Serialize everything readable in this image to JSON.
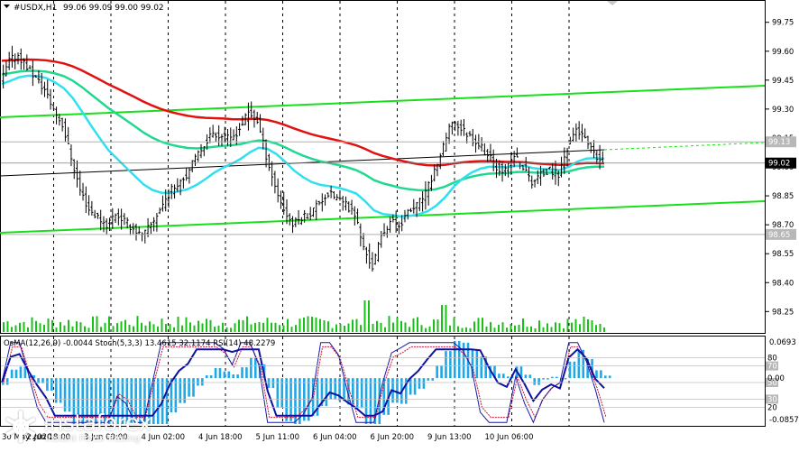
{
  "chart_info": {
    "symbol_label": "#USDX,H1",
    "ohlc_text": "99.06 99.09 99.00 99.02",
    "indicators_text": "OsMA(12,26,9) -0.0044  Stoch(5,3,3) 13.4615 32.1174  RSI(14) 48.2279"
  },
  "colors": {
    "ema_red": "#e31010",
    "ema_green": "#20d890",
    "ema_cyan": "#30e0f0",
    "channel_green": "#18e018",
    "trend_black": "#000000",
    "osma_bars": "#1fa8e8",
    "stoch_main": "#1a1aa8",
    "stoch_signal": "#d01030",
    "rsi_line": "#1010a0",
    "volume_bars": "#18c018",
    "current_price_box": "#000000",
    "level_box": "#b8b8b8"
  },
  "price_axis": {
    "labels": [
      "99.75",
      "99.60",
      "99.45",
      "99.30",
      "99.15",
      "99.00",
      "98.85",
      "98.70",
      "98.55",
      "98.40",
      "98.25"
    ],
    "marked_levels": [
      "99.13",
      "98.65"
    ],
    "current_price": "99.02",
    "min": 98.2,
    "max": 99.8
  },
  "indicator_axis": {
    "top_value": "0.0693",
    "bottom_value": "-0.0857",
    "level_labels": [
      "80",
      "70",
      "50",
      "0.00",
      "30",
      "20"
    ]
  },
  "time_axis": {
    "labels": [
      "30 May 2020",
      "2 Jun 18:00",
      "3 Jun 09:00",
      "4 Jun 02:00",
      "4 Jun 18:00",
      "5 Jun 11:00",
      "6 Jun 04:00",
      "6 Jun 20:00",
      "9 Jun 13:00",
      "10 Jun 06:00"
    ]
  },
  "logo": {
    "brand": "instaforex",
    "tagline": "Instant Forex Trading"
  },
  "chart_data": {
    "type": "candlestick",
    "symbol": "#USDX",
    "timeframe": "H1",
    "last_bar": {
      "open": 99.06,
      "high": 99.09,
      "low": 99.0,
      "close": 99.02
    },
    "ylim": [
      98.2,
      99.8
    ],
    "close_series": [
      99.43,
      99.55,
      99.58,
      99.52,
      99.46,
      99.4,
      99.3,
      99.22,
      99.05,
      98.88,
      98.78,
      98.74,
      98.7,
      98.76,
      98.72,
      98.68,
      98.64,
      98.7,
      98.78,
      98.86,
      98.92,
      98.96,
      99.04,
      99.12,
      99.18,
      99.16,
      99.14,
      99.2,
      99.28,
      99.24,
      99.06,
      98.9,
      98.78,
      98.7,
      98.74,
      98.76,
      98.82,
      98.86,
      98.84,
      98.8,
      98.76,
      98.58,
      98.48,
      98.64,
      98.72,
      98.7,
      98.76,
      98.8,
      98.86,
      98.98,
      99.1,
      99.24,
      99.2,
      99.16,
      99.12,
      99.06,
      99.0,
      98.98,
      99.06,
      99.0,
      98.92,
      98.96,
      98.98,
      98.96,
      99.1,
      99.2,
      99.14,
      99.06,
      99.02
    ],
    "indicators": {
      "osma": {
        "value": -0.0044,
        "range": [
          -0.0857,
          0.0693
        ]
      },
      "stochastic": {
        "params": "5,3,3",
        "main": 13.4615,
        "signal": 32.1174,
        "levels": [
          20,
          80
        ]
      },
      "rsi": {
        "params": "14",
        "value": 48.2279,
        "levels": [
          30,
          50,
          70
        ]
      }
    },
    "levels": [
      99.13,
      98.65
    ]
  }
}
